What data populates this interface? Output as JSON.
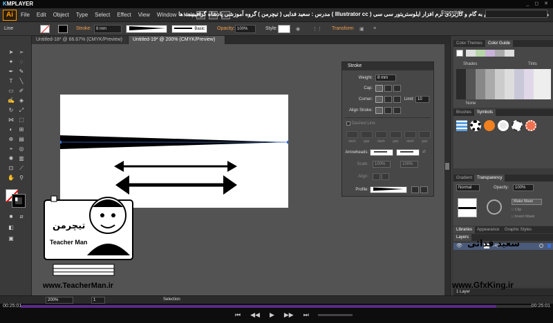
{
  "player": {
    "brand_k": "K",
    "brand_rest": "MPLAYER",
    "window_controls": "_ ◻ ✕",
    "time_elapsed": "00:25:01",
    "time_remaining": "00:25:01",
    "progress_fraction": 0.93,
    "controls": [
      "⏮",
      "◀◀",
      "▶",
      "▶▶",
      "⏭"
    ]
  },
  "menubar": {
    "logo": "Ai",
    "items": [
      "File",
      "Edit",
      "Object",
      "Type",
      "Select",
      "Effect",
      "View",
      "Window",
      "Help"
    ],
    "btn_br": "Br",
    "btn_st": "St",
    "course_title": "مجموعه آموزشی جامع ، گام به گام و کاربردی نرم افزار ایلوستریتور سی سی ( Illustrator cc )  مدرس : سعید فدایی ( تیچرمن ) گروه آموزشی پادشاه گرافیست ها",
    "essentials": "Essentials"
  },
  "controlbar": {
    "selection_label": "Line",
    "stroke_label": "Stroke:",
    "stroke_value": "8 mm",
    "profile_label": "Basic",
    "opacity_label": "Opacity:",
    "opacity_value": "100%",
    "style_label": "Style:",
    "transform_label": "Transform"
  },
  "doc_tabs": [
    {
      "label": "Untitled-18* @ 66.67% (CMYK/Preview)"
    },
    {
      "label": "Untitled-19* @ 200% (CMYK/Preview)"
    }
  ],
  "stroke_panel": {
    "title": "Stroke",
    "weight_label": "Weight:",
    "weight_value": "8 mm",
    "cap_label": "Cap:",
    "corner_label": "Corner:",
    "limit_label": "Limit:",
    "limit_value": "10",
    "align_label": "Align Stroke:",
    "dashed_label": "Dashed Line",
    "dash_labels": [
      "dash",
      "gap",
      "dash",
      "gap",
      "dash",
      "gap"
    ],
    "arrowheads_label": "Arrowheads:",
    "scale_label": "Scale:",
    "scale_value_1": "100%",
    "scale_value_2": "100%",
    "align_arrows_label": "Align:",
    "profile_label": "Profile:"
  },
  "right_panels": {
    "tab_color_themes": "Color Themes",
    "tab_color_guide": "Color Guide",
    "shades_label": "Shades",
    "tints_label": "Tints",
    "none_label": "None",
    "tab_brushes": "Brushes",
    "tab_symbols": "Symbols",
    "tab_gradient": "Gradient",
    "tab_transparency": "Transparency",
    "blend_mode": "Normal",
    "opacity_label": "Opacity:",
    "opacity_value": "100%",
    "make_mask": "Make Mask",
    "clip_label": "Clip",
    "invert_mask": "Invert Mask",
    "tab_libraries": "Libraries",
    "tab_appearance": "Appearance",
    "tab_graphic_styles": "Graphic Styles",
    "tab_layers": "Layers",
    "layer_name": "Layer 1",
    "layers_count": "1 Layer"
  },
  "bottombar": {
    "zoom": "200%",
    "page": "1",
    "status": "Selection"
  },
  "watermark": {
    "logo_fa": "تیچرمن",
    "logo_en": "Teacher Man",
    "url_left": "www.TeacherMan.ir",
    "name_fa": "سعید فدائی",
    "url_right": "www.GfxKing.ir"
  },
  "colors": {
    "accent": "#ff9a00",
    "link_orange": "#f59d4a",
    "panel_bg": "#474747",
    "workspace_bg": "#535353"
  }
}
